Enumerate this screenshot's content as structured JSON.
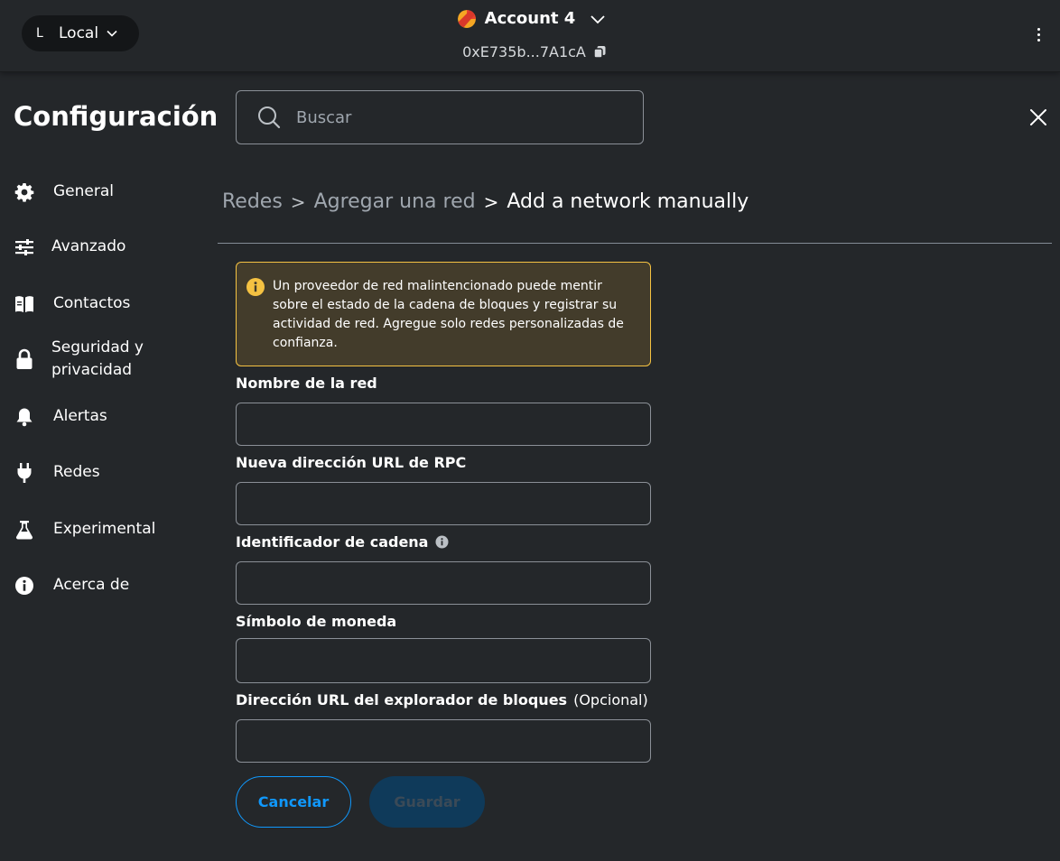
{
  "colors": {
    "background": "#24272a",
    "accent": "#1098fc",
    "warning_border": "#f5c242",
    "warning_bg": "#433c2b",
    "muted_text": "#9fa6ae"
  },
  "header": {
    "network": {
      "letter": "L",
      "label": "Local"
    },
    "account": {
      "name": "Account 4",
      "address": "0xE735b...7A1cA"
    }
  },
  "settings": {
    "title": "Configuración",
    "search_placeholder": "Buscar"
  },
  "sidebar": {
    "items": [
      {
        "label": "General",
        "icon": "gear-icon"
      },
      {
        "label": "Avanzado",
        "icon": "sliders-icon"
      },
      {
        "label": "Contactos",
        "icon": "book-icon"
      },
      {
        "label": "Seguridad y privacidad",
        "icon": "lock-icon"
      },
      {
        "label": "Alertas",
        "icon": "bell-icon"
      },
      {
        "label": "Redes",
        "icon": "plug-icon"
      },
      {
        "label": "Experimental",
        "icon": "flask-icon"
      },
      {
        "label": "Acerca de",
        "icon": "info-icon"
      }
    ]
  },
  "breadcrumb": {
    "items": [
      "Redes",
      "Agregar una red",
      "Add a network manually"
    ],
    "separator": ">"
  },
  "warning": {
    "text": "Un proveedor de red malintencionado puede mentir sobre el estado de la cadena de bloques y registrar su actividad de red. Agregue solo redes personalizadas de confianza."
  },
  "form": {
    "network_name_label": "Nombre de la red",
    "network_name_value": "",
    "rpc_url_label": "Nueva dirección URL de RPC",
    "rpc_url_value": "",
    "chain_id_label": "Identificador de cadena",
    "chain_id_value": "",
    "currency_symbol_label": "Símbolo de moneda",
    "currency_symbol_value": "",
    "explorer_url_label": "Dirección URL del explorador de bloques",
    "explorer_url_optional": "(Opcional)",
    "explorer_url_value": ""
  },
  "buttons": {
    "cancel": "Cancelar",
    "save": "Guardar"
  }
}
